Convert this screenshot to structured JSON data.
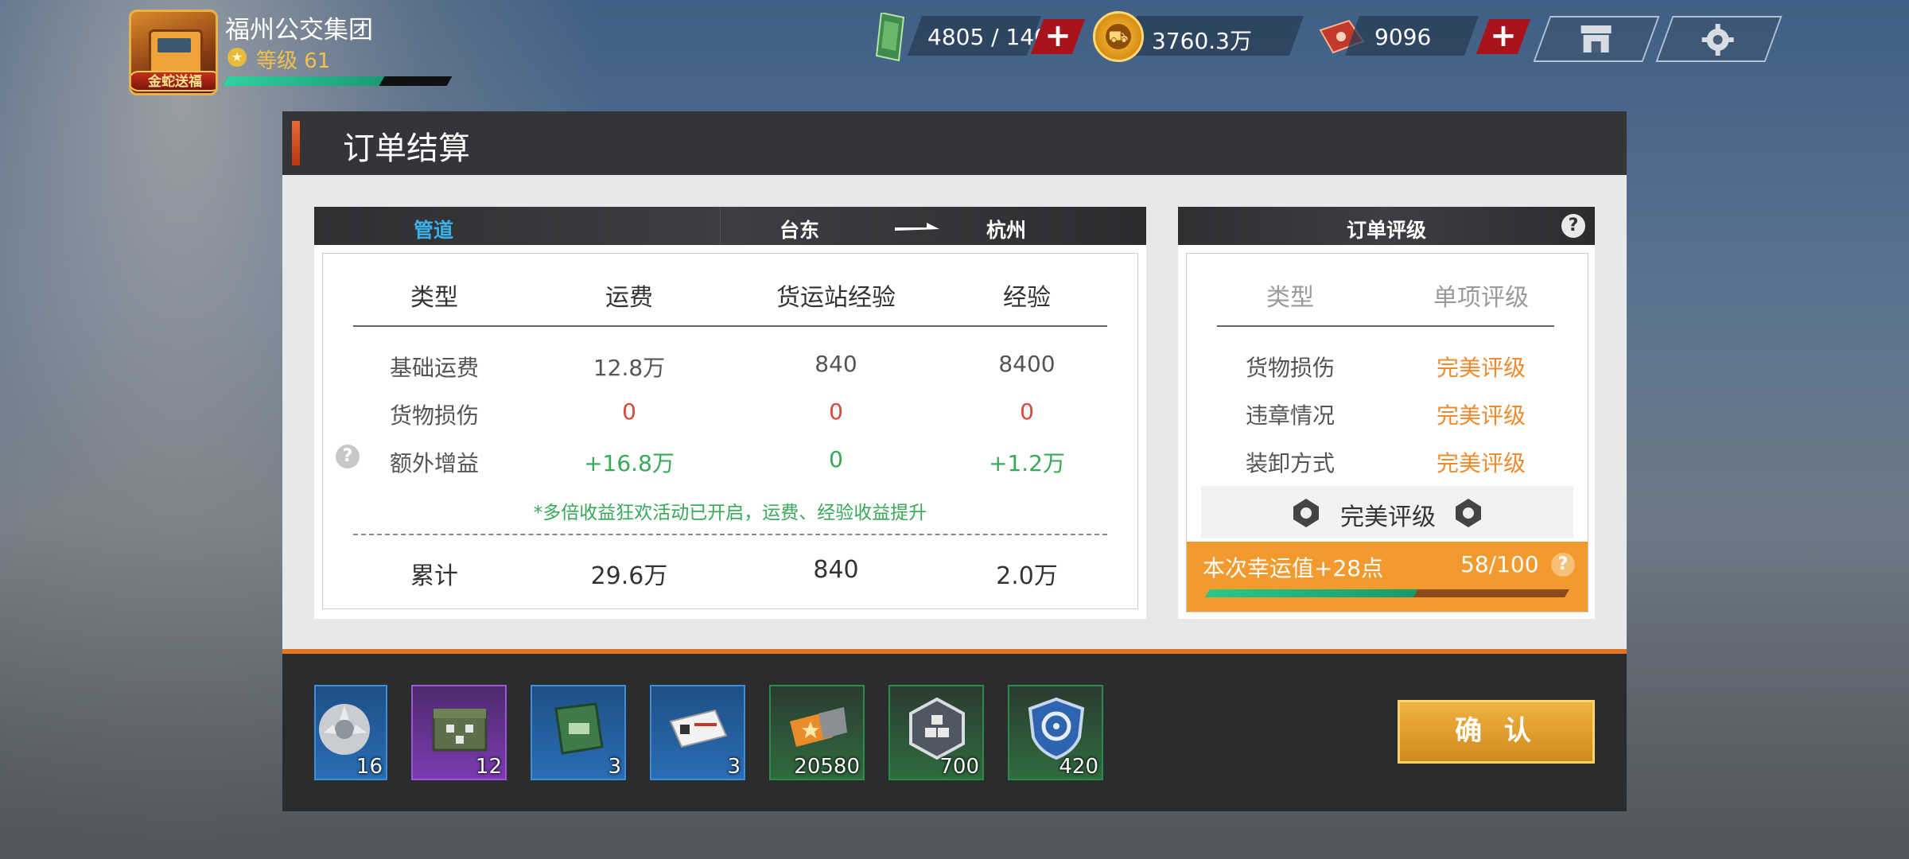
{
  "player": {
    "name": "福州公交集团",
    "level_label": "等级 61",
    "avatar_badge": "金蛇送福",
    "xp_fraction": 0.7
  },
  "resources": {
    "fuel": "4805 / 140",
    "coins": "3760.3万",
    "tickets": "9096",
    "plus_symbol": "+"
  },
  "colors": {
    "accent_orange": "#e2741f",
    "red_value": "#d8493a",
    "green_value": "#39a858",
    "grade_orange": "#f08a2e"
  },
  "panel": {
    "title": "订单结算",
    "route": {
      "cargo": "管道",
      "from": "台东",
      "to": "杭州"
    },
    "table": {
      "headers": [
        "类型",
        "运费",
        "货运站经验",
        "经验"
      ],
      "rows": [
        {
          "label": "基础运费",
          "values": [
            "12.8万",
            "840",
            "8400"
          ]
        },
        {
          "label": "货物损伤",
          "values": [
            "0",
            "0",
            "0"
          ]
        },
        {
          "label": "额外增益",
          "values": [
            "+16.8万",
            "0",
            "+1.2万"
          ]
        }
      ],
      "note": "*多倍收益狂欢活动已开启，运费、经验收益提升",
      "total": {
        "label": "累计",
        "values": [
          "29.6万",
          "840",
          "2.0万"
        ]
      }
    },
    "rating": {
      "title": "订单评级",
      "headers": [
        "类型",
        "单项评级"
      ],
      "rows": [
        {
          "label": "货物损伤",
          "grade": "完美评级"
        },
        {
          "label": "违章情况",
          "grade": "完美评级"
        },
        {
          "label": "装卸方式",
          "grade": "完美评级"
        }
      ],
      "overall": "完美评级",
      "luck_label": "本次幸运值+28点",
      "luck_progress_text": "58/100",
      "luck_fraction": 0.58,
      "help": "?"
    },
    "rewards": [
      {
        "icon": "hubcap-icon",
        "qty": "16"
      },
      {
        "icon": "ammo-crate-icon",
        "qty": "12"
      },
      {
        "icon": "truck-manual-icon",
        "qty": "3"
      },
      {
        "icon": "license-card-icon",
        "qty": "3"
      },
      {
        "icon": "star-ticket-icon",
        "qty": "20580"
      },
      {
        "icon": "cargo-hex-badge-icon",
        "qty": "700"
      },
      {
        "icon": "steering-shield-icon",
        "qty": "420"
      }
    ],
    "confirm_label": "确 认"
  }
}
